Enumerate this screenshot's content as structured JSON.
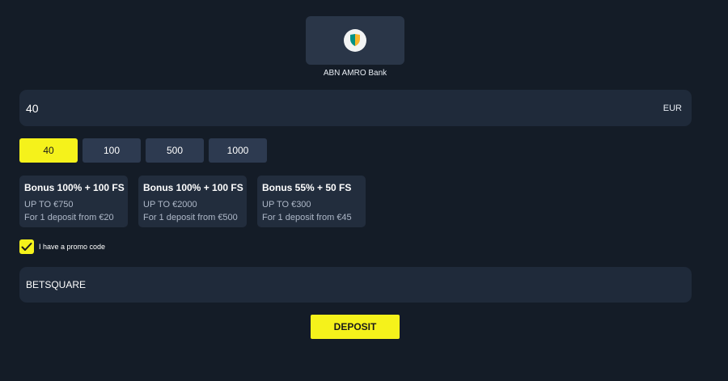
{
  "bank": {
    "name": "ABN AMRO Bank",
    "logo_icon": "abn-amro-shield-icon"
  },
  "amount": {
    "value": "40",
    "currency": "EUR"
  },
  "presets": [
    {
      "label": "40",
      "selected": true
    },
    {
      "label": "100",
      "selected": false
    },
    {
      "label": "500",
      "selected": false
    },
    {
      "label": "1000",
      "selected": false
    }
  ],
  "bonuses": [
    {
      "title": "Bonus 100% + 100 FS",
      "max": "UP TO €750",
      "condition": "For 1 deposit from €20"
    },
    {
      "title": "Bonus 100% + 100 FS",
      "max": "UP TO €2000",
      "condition": "For 1 deposit from €500"
    },
    {
      "title": "Bonus 55% + 50 FS",
      "max": "UP TO €300",
      "condition": "For 1 deposit from €45"
    }
  ],
  "promo": {
    "checked": true,
    "label": "I have a promo code",
    "code": "BETSQUARE"
  },
  "deposit": {
    "label": "DEPOSIT"
  },
  "colors": {
    "background": "#141c27",
    "accent": "#f5f21b",
    "field": "#1f2a3a",
    "card": "#222d3d"
  }
}
